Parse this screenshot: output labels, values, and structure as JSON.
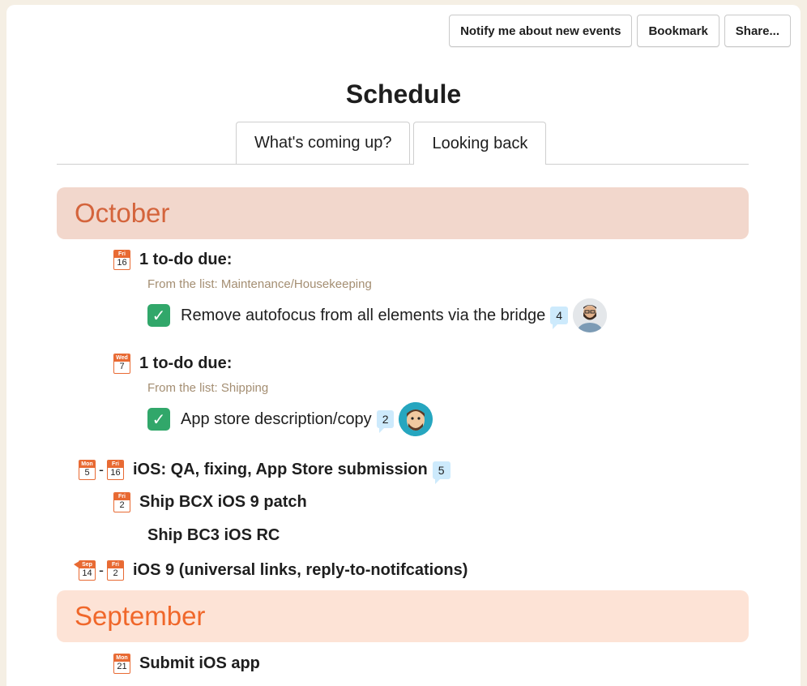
{
  "toolbar": {
    "notify_label": "Notify me about new events",
    "bookmark_label": "Bookmark",
    "share_label": "Share..."
  },
  "page_title": "Schedule",
  "tabs": [
    {
      "label": "What's coming up?",
      "active": false
    },
    {
      "label": "Looking back",
      "active": true
    }
  ],
  "colors": {
    "october_bg": "#f2d7cc",
    "october_text": "#d4643c",
    "september_bg": "#fde3d6",
    "september_text": "#f0672a",
    "calendar_accent": "#e86a33",
    "check_green": "#31a76a",
    "bubble_blue": "#cdeafc",
    "list_name": "#a48e72"
  },
  "months": {
    "october": "October",
    "september": "September"
  },
  "october_groups": [
    {
      "cal": {
        "day_name": "Fri",
        "day": "16"
      },
      "heading": "1 to-do due:",
      "list_line": "From the list: Maintenance/Housekeeping",
      "todo": {
        "text": "Remove autofocus from all elements via the bridge",
        "comments": "4",
        "avatar": "bearded-man-avatar"
      }
    },
    {
      "cal": {
        "day_name": "Wed",
        "day": "7"
      },
      "heading": "1 to-do due:",
      "list_line": "From the list: Shipping",
      "todo": {
        "text": "App store description/copy",
        "comments": "2",
        "avatar": "cartoon-man-avatar"
      }
    }
  ],
  "events": [
    {
      "start": {
        "day_name": "Mon",
        "day": "5"
      },
      "end": {
        "day_name": "Fri",
        "day": "16"
      },
      "title": "iOS: QA, fixing, App Store submission",
      "comments": "5"
    },
    {
      "cal": {
        "day_name": "Fri",
        "day": "2"
      },
      "title": "Ship BCX iOS 9 patch"
    },
    {
      "title": "Ship BC3 iOS RC"
    },
    {
      "start": {
        "day_name": "Sep",
        "day": "14"
      },
      "end": {
        "day_name": "Fri",
        "day": "2"
      },
      "title": "iOS 9 (universal links, reply-to-notifcations)"
    }
  ],
  "september_events": [
    {
      "cal": {
        "day_name": "Mon",
        "day": "21"
      },
      "title": "Submit iOS app"
    }
  ]
}
